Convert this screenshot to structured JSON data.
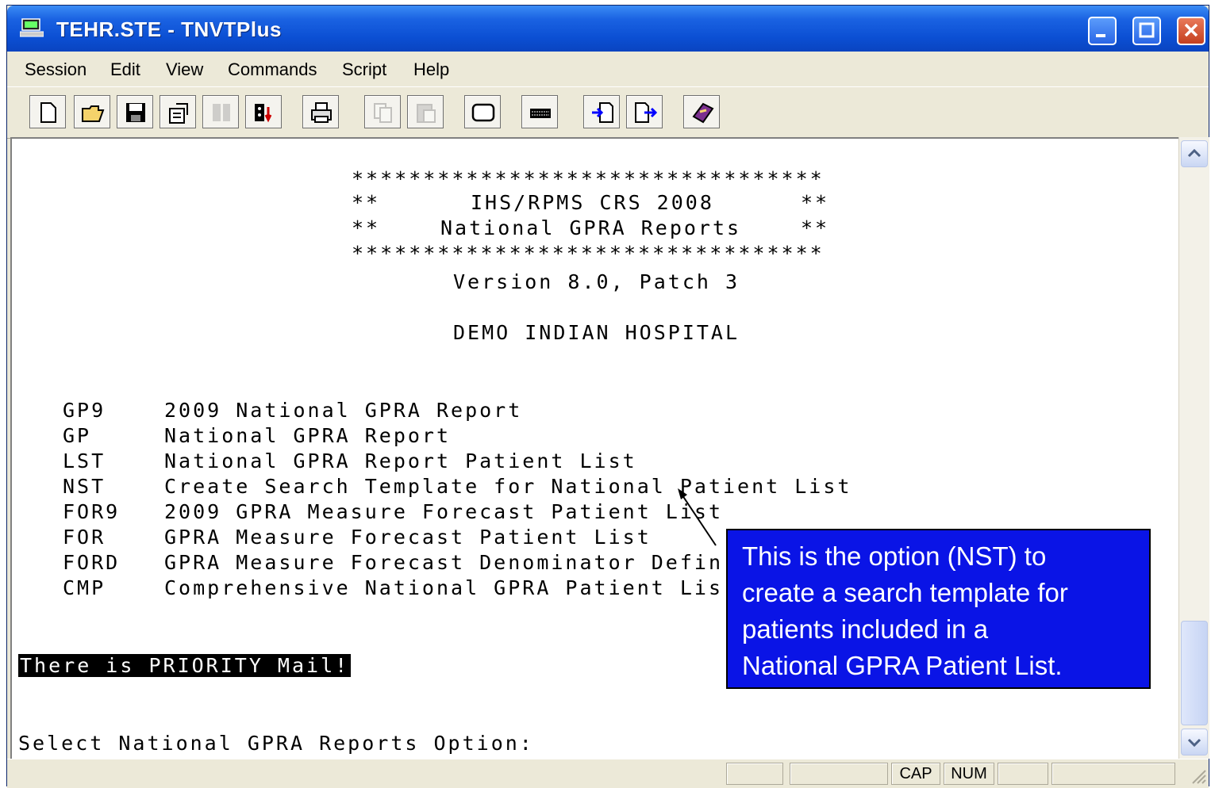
{
  "window": {
    "title": "TEHR.STE - TNVTPlus"
  },
  "menu": [
    "Session",
    "Edit",
    "View",
    "Commands",
    "Script",
    "Help"
  ],
  "terminal": {
    "banner_border": "*********************************",
    "banner_line1_left": "**",
    "banner_line1_text": "IHS/RPMS CRS 2008",
    "banner_line1_right": "**",
    "banner_line2_left": "**",
    "banner_line2_text": "National GPRA Reports",
    "banner_line2_right": "**",
    "version": "Version 8.0, Patch 3",
    "facility": "DEMO INDIAN HOSPITAL",
    "options": [
      {
        "code": "GP9",
        "desc": "2009 National GPRA Report"
      },
      {
        "code": "GP",
        "desc": "National GPRA Report"
      },
      {
        "code": "LST",
        "desc": "National GPRA Report Patient List"
      },
      {
        "code": "NST",
        "desc": "Create Search Template for National Patient List"
      },
      {
        "code": "FOR9",
        "desc": "2009 GPRA Measure Forecast Patient List"
      },
      {
        "code": "FOR",
        "desc": "GPRA Measure Forecast Patient List"
      },
      {
        "code": "FORD",
        "desc": "GPRA Measure Forecast Denominator Defin"
      },
      {
        "code": "CMP",
        "desc": "Comprehensive National GPRA Patient Lis"
      }
    ],
    "priority_mail": "There is PRIORITY Mail!",
    "prompt": "Select National GPRA Reports Option:"
  },
  "callout": {
    "line1": "This is the option (NST) to",
    "line2": "create a search template for",
    "line3": "patients included in a",
    "line4": "National GPRA Patient List."
  },
  "statusbar": {
    "cap": "CAP",
    "num": "NUM"
  },
  "colors": {
    "titlebar": "#0b4fd3",
    "callout_bg": "#0a14e6",
    "terminal_bg": "#ffffff"
  }
}
